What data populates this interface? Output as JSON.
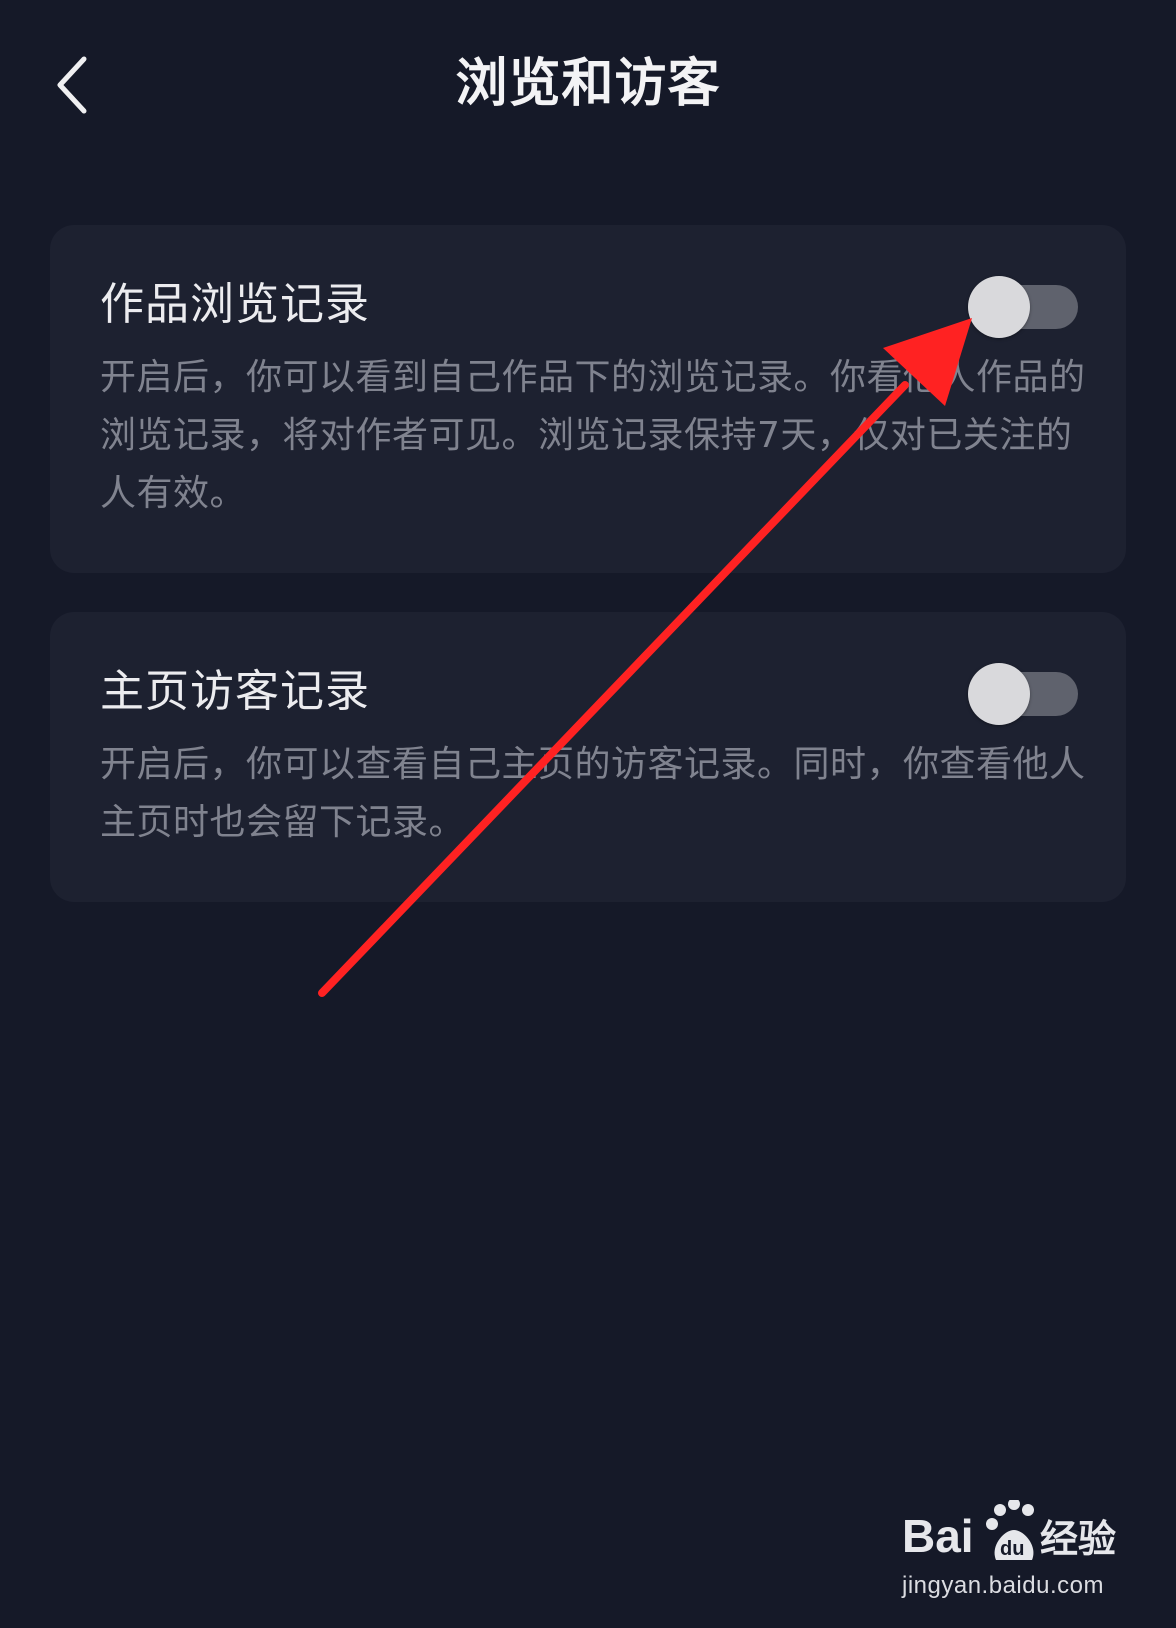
{
  "header": {
    "title": "浏览和访客",
    "back_icon": "chevron-left-icon"
  },
  "settings": [
    {
      "title": "作品浏览记录",
      "description": "开启后，你可以看到自己作品下的浏览记录。你看他人作品的浏览记录，将对作者可见。浏览记录保持7天，仅对已关注的人有效。",
      "enabled": false
    },
    {
      "title": "主页访客记录",
      "description": "开启后，你可以查看自己主页的访客记录。同时，你查看他人主页时也会留下记录。",
      "enabled": false
    }
  ],
  "colors": {
    "background": "#151928",
    "card": "#1d2130",
    "toggle_track_off": "#5f626d",
    "toggle_knob": "#d9d9dc",
    "annotation_arrow": "#ff2222"
  },
  "watermark": {
    "logo_text": "Bai du 经验",
    "url": "jingyan.baidu.com"
  }
}
